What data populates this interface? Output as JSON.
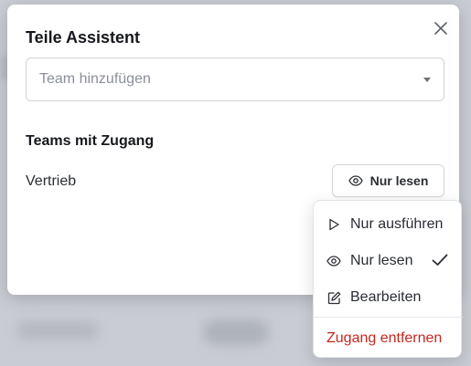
{
  "dialog": {
    "title": "Teile Assistent",
    "close_icon": "close-icon"
  },
  "team_select": {
    "placeholder": "Team hinzufügen",
    "caret_icon": "caret-down-icon"
  },
  "access_section": {
    "title": "Teams mit Zugang",
    "teams": [
      {
        "name": "Vertrieb",
        "permission_label": "Nur lesen",
        "permission_icon": "eye-icon"
      }
    ]
  },
  "permission_menu": {
    "items": [
      {
        "label": "Nur ausführen",
        "icon": "play-icon",
        "selected": false
      },
      {
        "label": "Nur lesen",
        "icon": "eye-icon",
        "selected": true
      },
      {
        "label": "Bearbeiten",
        "icon": "edit-icon",
        "selected": false
      }
    ],
    "remove_label": "Zugang entfernen",
    "colors": {
      "danger": "#c4271f",
      "text": "#2a2d33"
    }
  }
}
